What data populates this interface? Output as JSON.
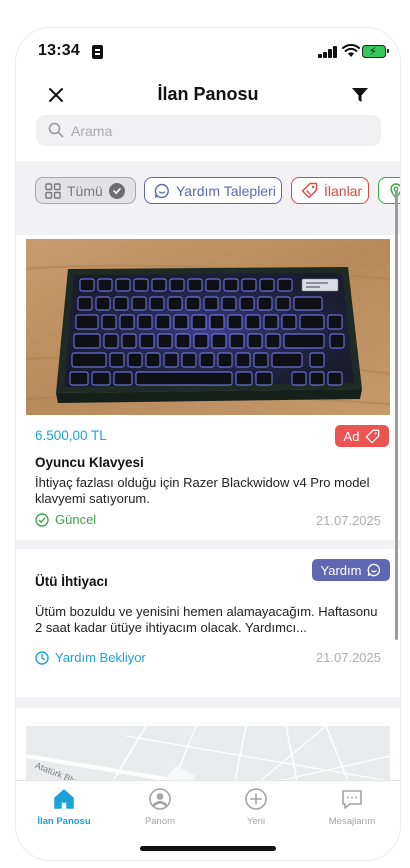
{
  "status_bar": {
    "time": "13:34"
  },
  "header": {
    "title": "İlan Panosu",
    "close_icon": "close-icon",
    "filter_icon": "filter-icon"
  },
  "search": {
    "placeholder": "Arama",
    "value": ""
  },
  "filters": [
    {
      "label": "Tümü",
      "selected": true,
      "color": "#7a7a7e"
    },
    {
      "label": "Yardım Talepleri",
      "selected": false,
      "color": "#5c66b3"
    },
    {
      "label": "İlanlar",
      "selected": false,
      "color": "#e2473e"
    },
    {
      "label": "",
      "selected": false,
      "color": "#3aa64a"
    }
  ],
  "feed": [
    {
      "type": "ad",
      "price": "6.500,00 TL",
      "badge": "Ad",
      "title": "Oyuncu Klavyesi",
      "description": "İhtiyaç fazlası olduğu için Razer Blackwidow v4 Pro model klavyemi satıyorum.",
      "status": "Güncel",
      "date": "21.07.2025",
      "image": "keyboard-photo"
    },
    {
      "type": "help",
      "badge": "Yardım",
      "title": "Ütü İhtiyacı",
      "description": "Ütüm bozuldu ve yenisini hemen alamayacağım. Haftasonu 2 saat kadar ütüye ihtiyacım olacak. Yardımcı...",
      "status": "Yardım Bekliyor",
      "date": "21.07.2025"
    },
    {
      "type": "map",
      "map_label": "Atatürk Blv"
    }
  ],
  "tabbar": [
    {
      "label": "İlan Panosu",
      "icon": "home-icon",
      "active": true
    },
    {
      "label": "Panom",
      "icon": "profile-icon",
      "active": false
    },
    {
      "label": "Yeni",
      "icon": "plus-circle-icon",
      "active": false
    },
    {
      "label": "Mesajlarım",
      "icon": "message-icon",
      "active": false
    }
  ],
  "colors": {
    "accent": "#1ba3d8",
    "ad_red": "#ec5353",
    "help_purple": "#5f68b2",
    "ok_green": "#3aa64a"
  }
}
